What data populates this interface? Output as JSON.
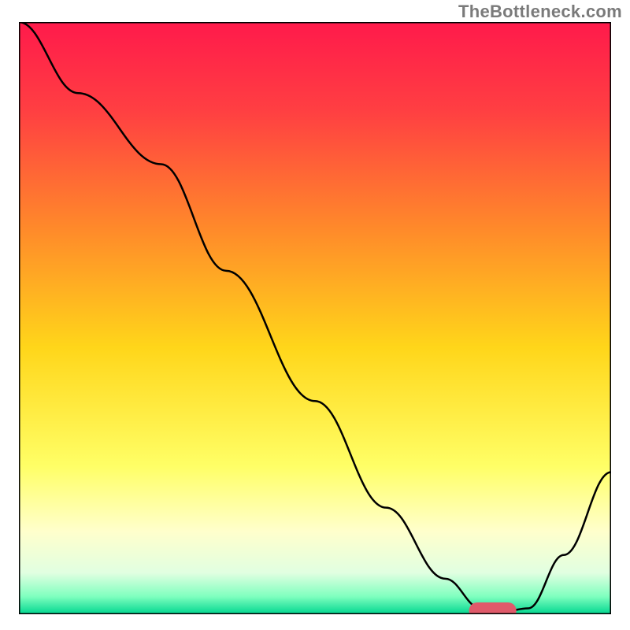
{
  "watermark": "TheBottleneck.com",
  "chart_data": {
    "type": "line",
    "title": "",
    "xlabel": "",
    "ylabel": "",
    "xlim": [
      0,
      100
    ],
    "ylim": [
      0,
      100
    ],
    "background_gradient": {
      "stops": [
        {
          "pos": 0.0,
          "color": "#ff1a4b"
        },
        {
          "pos": 0.15,
          "color": "#ff3f42"
        },
        {
          "pos": 0.35,
          "color": "#ff8a2a"
        },
        {
          "pos": 0.55,
          "color": "#ffd61a"
        },
        {
          "pos": 0.75,
          "color": "#ffff66"
        },
        {
          "pos": 0.86,
          "color": "#ffffcc"
        },
        {
          "pos": 0.93,
          "color": "#e1ffe1"
        },
        {
          "pos": 0.97,
          "color": "#7fffbf"
        },
        {
          "pos": 1.0,
          "color": "#00d68f"
        }
      ]
    },
    "series": [
      {
        "name": "bottleneck-curve",
        "color": "#000000",
        "x": [
          0,
          10,
          24,
          35,
          50,
          62,
          72,
          78,
          82,
          86,
          92,
          100
        ],
        "y": [
          100,
          88,
          76,
          58,
          36,
          18,
          6,
          1,
          0.5,
          1,
          10,
          24
        ]
      }
    ],
    "marker": {
      "name": "target-marker",
      "color": "#e05a6a",
      "x_start": 76,
      "x_end": 84,
      "y": 0.6,
      "thickness": 2.8
    },
    "axes": {
      "show_border": true,
      "border_color": "#000000",
      "border_width": 3
    }
  }
}
